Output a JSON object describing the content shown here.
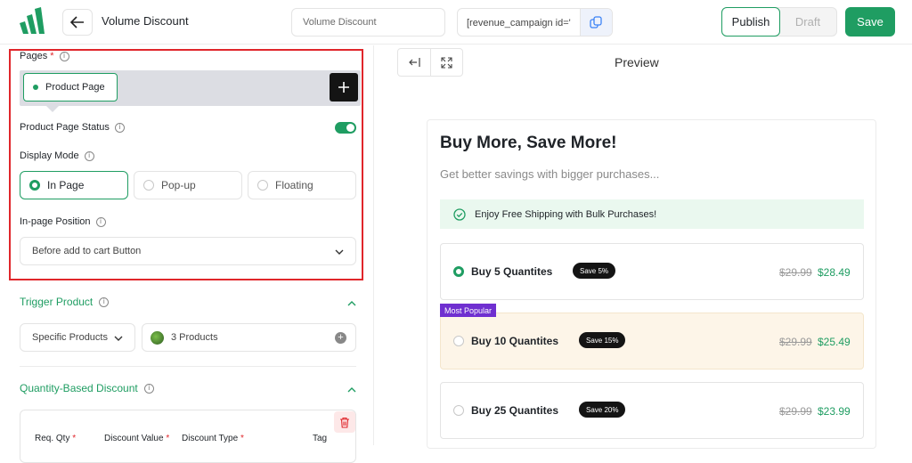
{
  "header": {
    "title": "Volume Discount",
    "name_field_value": "Volume Discount",
    "shortcode": "[revenue_campaign id='",
    "publish_label": "Publish",
    "draft_label": "Draft",
    "save_label": "Save"
  },
  "settings": {
    "pages_label": "Pages",
    "required_mark": "*",
    "page_chip": "Product Page",
    "status_label": "Product Page Status",
    "status_on": true,
    "display_mode_label": "Display Mode",
    "modes": [
      "In Page",
      "Pop-up",
      "Floating"
    ],
    "selected_mode": "In Page",
    "position_label": "In-page Position",
    "position_value": "Before add to cart Button"
  },
  "trigger": {
    "title": "Trigger Product",
    "type_value": "Specific Products",
    "products_value": "3 Products"
  },
  "quantity": {
    "title": "Quantity-Based Discount",
    "columns": [
      "Req. Qty",
      "Discount Value",
      "Discount Type",
      "Tag"
    ]
  },
  "preview": {
    "title": "Preview",
    "heading": "Buy More, Save More!",
    "subheading": "Get better savings with bigger purchases...",
    "shipping_text": "Enjoy Free Shipping with Bulk Purchases!",
    "popular_tag": "Most Popular",
    "tiers": [
      {
        "name": "Buy 5 Quantites",
        "badge": "Save 5%",
        "old_price": "$29.99",
        "new_price": "$28.49",
        "selected": true
      },
      {
        "name": "Buy 10 Quantites",
        "badge": "Save 15%",
        "old_price": "$29.99",
        "new_price": "$25.49",
        "selected": false
      },
      {
        "name": "Buy 25 Quantites",
        "badge": "Save 20%",
        "old_price": "$29.99",
        "new_price": "$23.99",
        "selected": false
      }
    ]
  },
  "colors": {
    "accent": "#1f9d62",
    "highlight_frame": "#e0262b",
    "popular_tag": "#6f2fd0"
  },
  "icons": [
    "logo-icon",
    "arrow-left-icon",
    "copy-icon",
    "plus-icon",
    "info-icon",
    "chevron-down-icon",
    "chevron-up-icon",
    "collapse-panel-icon",
    "expand-icon",
    "check-circle-icon",
    "trash-icon"
  ]
}
